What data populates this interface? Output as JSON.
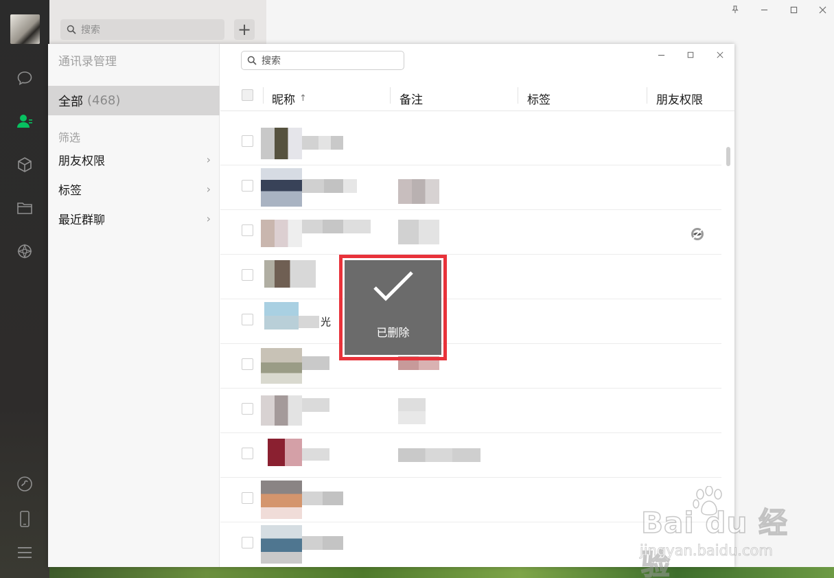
{
  "app": {
    "search_placeholder": "搜索",
    "add_button": "+"
  },
  "rail": {
    "icons": [
      "avatar",
      "chat-icon",
      "contacts-icon",
      "collections-icon",
      "files-icon",
      "moments-icon",
      "miniprogram-icon",
      "phone-icon",
      "menu-icon"
    ],
    "accent": "#07c160"
  },
  "modal": {
    "title": "通讯录管理",
    "search_placeholder": "搜索",
    "all_label": "全部",
    "all_count": "(468)",
    "filter_label": "筛选",
    "filters": [
      {
        "label": "朋友权限"
      },
      {
        "label": "标签"
      },
      {
        "label": "最近群聊"
      }
    ],
    "columns": {
      "nickname": "昵称",
      "sort_arrow": "↑",
      "remark": "备注",
      "tags": "标签",
      "permissions": "朋友权限"
    },
    "row_fragments": {
      "row5_text": "光"
    }
  },
  "toast": {
    "message": "已删除"
  },
  "watermark": {
    "brand": "Bai du 经验",
    "url": "jingyan.baidu.com"
  }
}
